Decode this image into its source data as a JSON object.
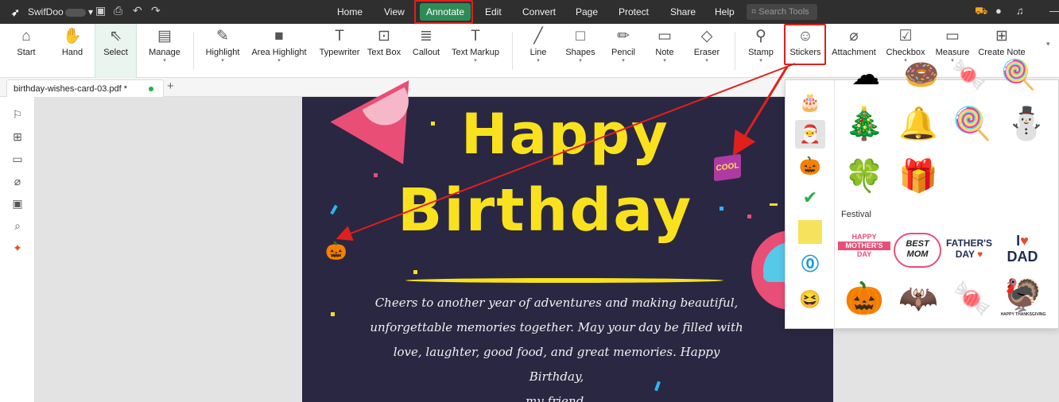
{
  "titlebar": {
    "app_name": "SwifDoo",
    "menus": [
      "Home",
      "View",
      "Annotate",
      "Edit",
      "Convert",
      "Page",
      "Protect",
      "Share",
      "Help"
    ],
    "active_menu": "Annotate",
    "search_placeholder": "Search Tools"
  },
  "toolbar": {
    "tools": [
      {
        "label": "Start",
        "icon": "home-icon",
        "glyph": "⌂"
      },
      {
        "label": "Hand",
        "icon": "hand-icon",
        "glyph": "✋"
      },
      {
        "label": "Select",
        "icon": "pointer-icon",
        "glyph": "⇖"
      },
      {
        "label": "Manage",
        "icon": "manage-icon",
        "glyph": "▤"
      },
      {
        "label": "Highlight",
        "icon": "highlight-icon",
        "glyph": "✎"
      },
      {
        "label": "Area Highlight",
        "icon": "area-highlight-icon",
        "glyph": "■"
      },
      {
        "label": "Typewriter",
        "icon": "typewriter-icon",
        "glyph": "T"
      },
      {
        "label": "Text Box",
        "icon": "text-box-icon",
        "glyph": "⊡"
      },
      {
        "label": "Callout",
        "icon": "callout-icon",
        "glyph": "≣"
      },
      {
        "label": "Text Markup",
        "icon": "text-markup-icon",
        "glyph": "T"
      },
      {
        "label": "Line",
        "icon": "line-icon",
        "glyph": "╱"
      },
      {
        "label": "Shapes",
        "icon": "shapes-icon",
        "glyph": "□"
      },
      {
        "label": "Pencil",
        "icon": "pencil-icon",
        "glyph": "✏"
      },
      {
        "label": "Note",
        "icon": "note-icon",
        "glyph": "▭"
      },
      {
        "label": "Eraser",
        "icon": "eraser-icon",
        "glyph": "◇"
      },
      {
        "label": "Stamp",
        "icon": "stamp-icon",
        "glyph": "⚲"
      },
      {
        "label": "Stickers",
        "icon": "stickers-icon",
        "glyph": "☺"
      },
      {
        "label": "Attachment",
        "icon": "attachment-icon",
        "glyph": "⌀"
      },
      {
        "label": "Checkbox",
        "icon": "checkbox-icon",
        "glyph": "☑"
      },
      {
        "label": "Measure",
        "icon": "measure-icon",
        "glyph": "▭"
      },
      {
        "label": "Create Note",
        "icon": "create-note-icon",
        "glyph": "⊞"
      }
    ]
  },
  "tab": {
    "filename": "birthday-wishes-card-03.pdf *"
  },
  "card": {
    "title_line1": "Happy",
    "title_line2": "Birthday",
    "badge": "COOL",
    "message": [
      "Cheers to another year of adventures and making beautiful,",
      "unforgettable memories together. May your day be filled with",
      "love, laughter, good food, and great memories. Happy Birthday,",
      "my friend."
    ]
  },
  "stickers_panel": {
    "section_label": "Festival",
    "sticker_texts": {
      "mothers_day": [
        "HAPPY",
        "MOTHER'S",
        "DAY"
      ],
      "best_mom": [
        "BEST",
        "MOM"
      ],
      "fathers_day": [
        "FATHER'S",
        "DAY"
      ],
      "i_love_dad": [
        "I",
        "DAD"
      ],
      "thanksgiving": "HAPPY THANKSGIVING"
    }
  },
  "colors": {
    "accent": "#2e8b57",
    "highlight_box": "#e0201c",
    "card_bg": "#2a2742",
    "title_yellow": "#f9e21d"
  }
}
